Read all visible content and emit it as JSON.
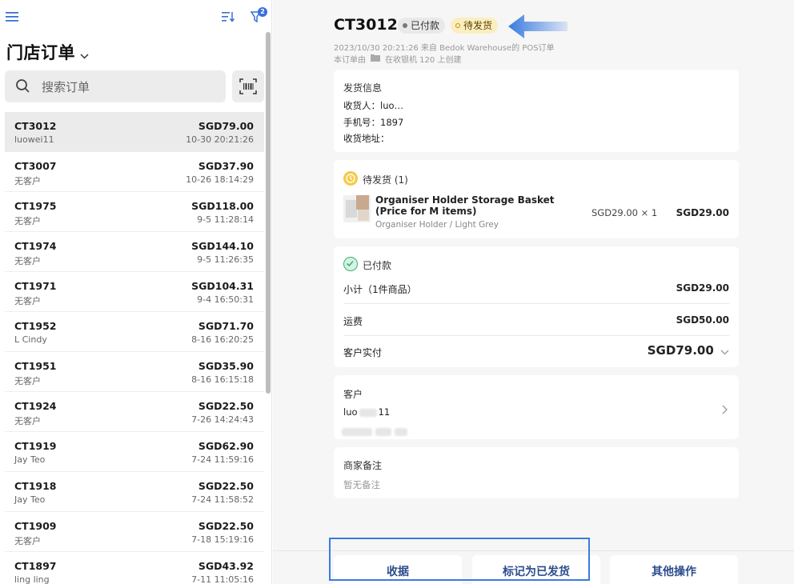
{
  "left_panel": {
    "title": "门店订单",
    "search_placeholder": "搜索订单",
    "filter_count": "2",
    "orders": [
      {
        "id": "CT3012",
        "amount": "SGD79.00",
        "customer": "luowei11",
        "time": "10-30 20:21:26",
        "active": true
      },
      {
        "id": "CT3007",
        "amount": "SGD37.90",
        "customer": "无客户",
        "time": "10-26 18:14:29"
      },
      {
        "id": "CT1975",
        "amount": "SGD118.00",
        "customer": "无客户",
        "time": "9-5 11:28:14"
      },
      {
        "id": "CT1974",
        "amount": "SGD144.10",
        "customer": "无客户",
        "time": "9-5 11:26:35"
      },
      {
        "id": "CT1971",
        "amount": "SGD104.31",
        "customer": "无客户",
        "time": "9-4 16:50:31"
      },
      {
        "id": "CT1952",
        "amount": "SGD71.70",
        "customer": "L Cindy",
        "time": "8-16 16:20:25"
      },
      {
        "id": "CT1951",
        "amount": "SGD35.90",
        "customer": "无客户",
        "time": "8-16 16:15:18"
      },
      {
        "id": "CT1924",
        "amount": "SGD22.50",
        "customer": "无客户",
        "time": "7-26 14:24:43"
      },
      {
        "id": "CT1919",
        "amount": "SGD62.90",
        "customer": "Jay Teo",
        "time": "7-24 11:59:16"
      },
      {
        "id": "CT1918",
        "amount": "SGD22.50",
        "customer": "Jay Teo",
        "time": "7-24 11:58:52"
      },
      {
        "id": "CT1909",
        "amount": "SGD22.50",
        "customer": "无客户",
        "time": "7-18 15:19:16"
      },
      {
        "id": "CT1897",
        "amount": "SGD43.92",
        "customer": "ling ling",
        "time": "7-11 11:05:16"
      }
    ]
  },
  "detail": {
    "order_id": "CT3012",
    "badge_paid": "已付款",
    "badge_pending": "待发货",
    "meta_line1": "2023/10/30 20:21:26 来自 Bedok Warehouse的 POS订单",
    "meta_line2_a": "本订单由",
    "meta_line2_b": "在收银机  120  上创建",
    "shipping": {
      "title": "发货信息",
      "recipient_label": "收货人：",
      "recipient_value": "luo…",
      "phone_label": "手机号：",
      "phone_value": "1897",
      "address_label": "收货地址："
    },
    "fulfillment": {
      "title": "待发货 (1)",
      "product_name": "Organiser Holder Storage Basket (Price for M items)",
      "variant": "Organiser Holder  / Light Grey",
      "qty": "SGD29.00 × 1",
      "total": "SGD29.00"
    },
    "payment": {
      "title": "已付款",
      "subtotal_label": "小计（1件商品）",
      "subtotal_value": "SGD29.00",
      "shipping_label": "运费",
      "shipping_value": "SGD50.00",
      "paid_label": "客户实付",
      "paid_value": "SGD79.00"
    },
    "customer": {
      "title": "客户",
      "name_a": "luo",
      "name_b": "11"
    },
    "notes": {
      "title": "商家备注",
      "empty": "暂无备注"
    }
  },
  "actions": {
    "receipt": "收据",
    "mark_shipped": "标记为已发货",
    "more": "其他操作"
  },
  "colors": {
    "accent": "#3a7be0",
    "pending_badge": "#fbeebf",
    "action_text": "#2c4c8c"
  }
}
